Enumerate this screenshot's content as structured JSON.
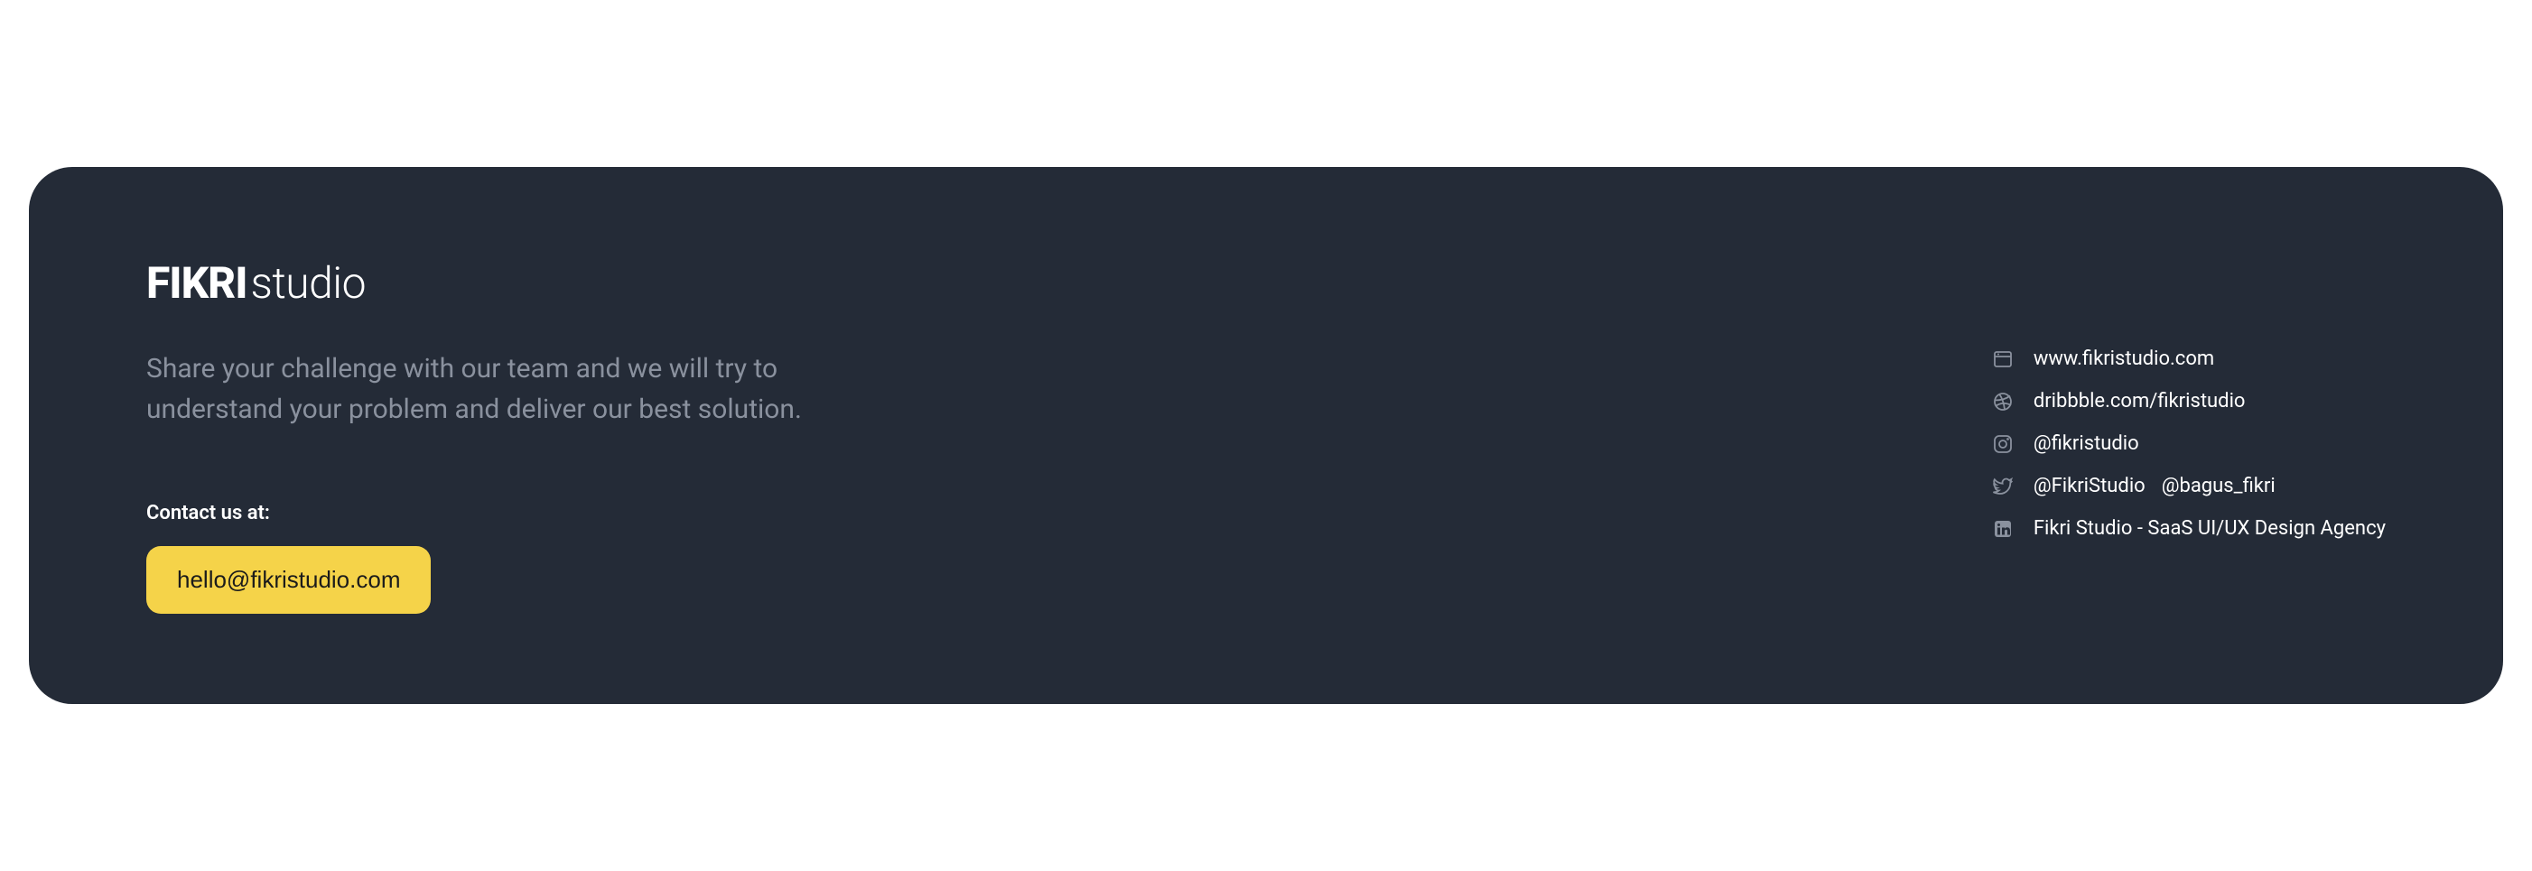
{
  "logo": {
    "part1": "FIKRI",
    "part2": "studio"
  },
  "tagline": "Share your challenge with our team and we will try to understand your problem and deliver our best solution.",
  "contact": {
    "label": "Contact us at:",
    "email": "hello@fikristudio.com"
  },
  "socials": {
    "website": "www.fikristudio.com",
    "dribbble": "dribbble.com/fikristudio",
    "instagram": "@fikristudio",
    "twitter1": "@FikriStudio",
    "twitter2": "@bagus_fikri",
    "linkedin": "Fikri Studio - SaaS UI/UX Design Agency"
  }
}
